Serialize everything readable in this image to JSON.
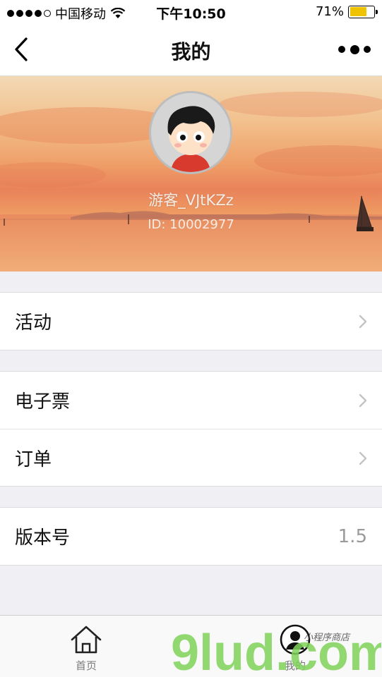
{
  "status_bar": {
    "carrier": "中国移动",
    "time": "下午10:50",
    "battery_percent": "71%",
    "battery_level": 0.71,
    "battery_color": "#f0c300"
  },
  "nav": {
    "title": "我的",
    "back_icon": "chevron-left-icon",
    "more_icon": "more-dots-icon"
  },
  "profile": {
    "username": "游客_VJtKZz",
    "user_id": "ID: 10002977"
  },
  "menu": {
    "group1": [
      {
        "label": "活动"
      }
    ],
    "group2": [
      {
        "label": "电子票"
      },
      {
        "label": "订单"
      }
    ],
    "version": {
      "label": "版本号",
      "value": "1.5"
    }
  },
  "tabs": [
    {
      "label": "首页",
      "icon": "home-icon"
    },
    {
      "label": "我的",
      "icon": "user-icon"
    }
  ],
  "watermark": {
    "logo": "9lud.com",
    "tagline": "小程序商店"
  }
}
